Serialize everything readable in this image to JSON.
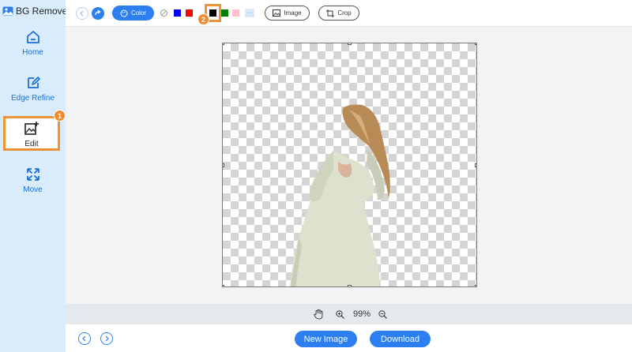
{
  "app": {
    "name": "BG Remover"
  },
  "sidebar": {
    "items": [
      {
        "label": "Home",
        "icon": "home-icon"
      },
      {
        "label": "Edge Refine",
        "icon": "edge-refine-icon"
      },
      {
        "label": "Edit",
        "icon": "edit-image-icon",
        "active": true
      },
      {
        "label": "Move",
        "icon": "move-icon"
      }
    ],
    "edit_step_badge": "1"
  },
  "toolbar": {
    "undo_icon": "undo-icon",
    "redo_icon": "redo-icon",
    "color_label": "Color",
    "swatches": [
      {
        "name": "none",
        "color": "transparent"
      },
      {
        "name": "blue",
        "color": "#0000ff"
      },
      {
        "name": "red",
        "color": "#ff0000"
      },
      {
        "name": "black",
        "color": "#000000",
        "selected": true
      },
      {
        "name": "green",
        "color": "#008000"
      },
      {
        "name": "pink",
        "color": "#ffc0cb"
      }
    ],
    "more_label": "···",
    "swatch_step_badge": "2",
    "image_label": "Image",
    "crop_label": "Crop"
  },
  "zoom": {
    "value": "99%"
  },
  "bottom": {
    "new_image_label": "New Image",
    "download_label": "Download"
  },
  "colors": {
    "accent": "#2d7ff0",
    "highlight": "#f0923a",
    "sidebar_bg": "#d8ecfb"
  }
}
